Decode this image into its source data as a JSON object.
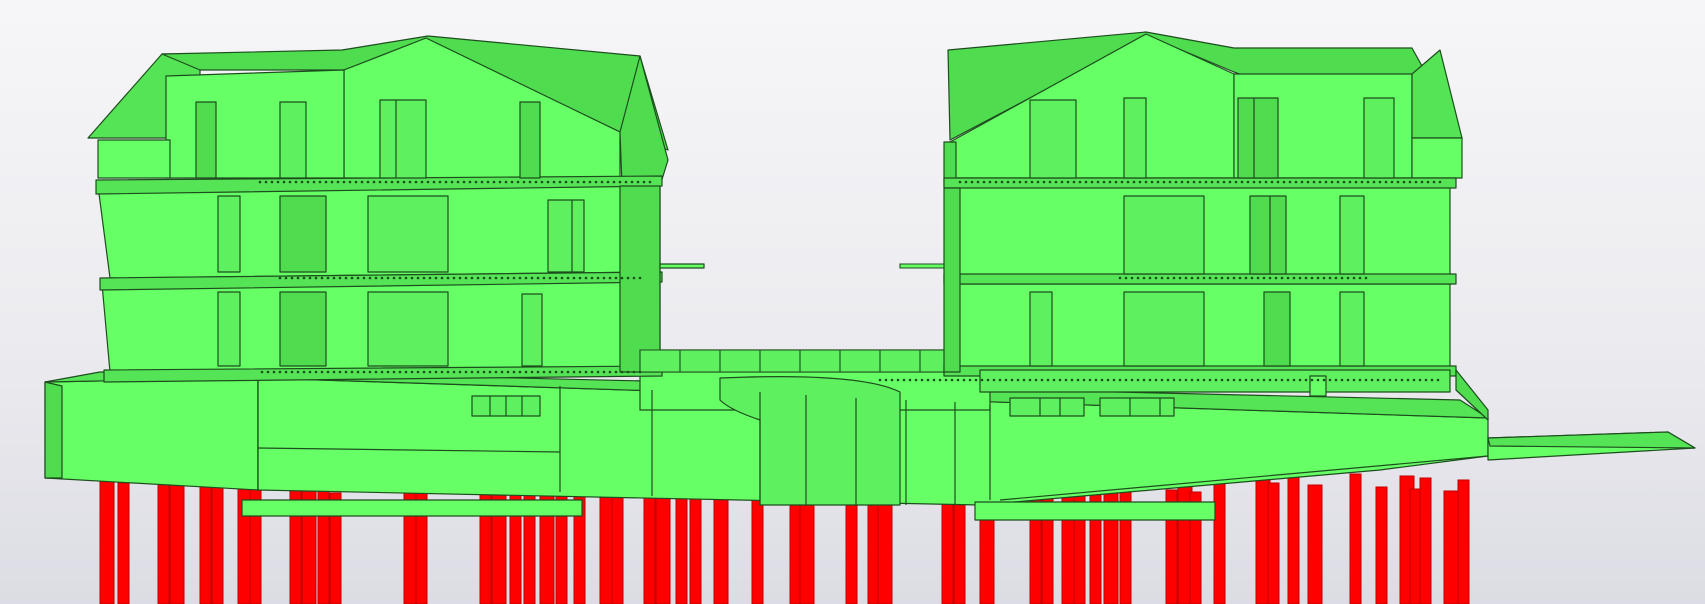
{
  "viewport": {
    "background_top": "#f6f6f8",
    "background_bottom": "#dcdce4"
  },
  "colors": {
    "building_fill": "#66ff66",
    "building_shade": "#4fdc4f",
    "building_roof": "#55e455",
    "building_dark": "#36b036",
    "edge_line": "#1d4d1d",
    "pile_fill": "#ff0000",
    "pile_shade": "#c00000"
  },
  "model": {
    "buildings": [
      {
        "name": "left-building",
        "floors": 3,
        "roof": "gable"
      },
      {
        "name": "right-building",
        "floors": 3,
        "roof": "gable"
      }
    ],
    "foundation": "podium-slab",
    "piles": "red-pile-columns"
  }
}
